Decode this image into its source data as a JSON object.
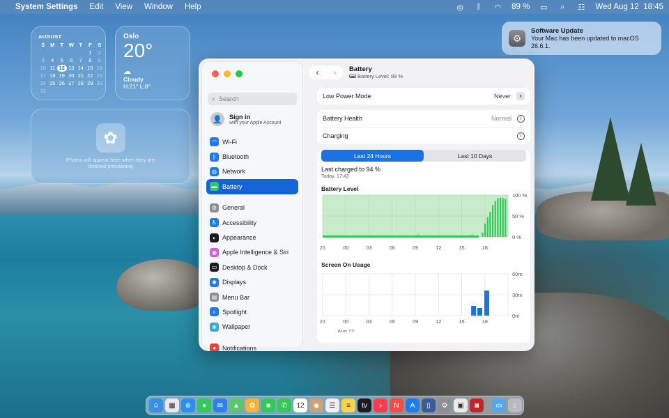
{
  "menubar": {
    "app_name": "System Settings",
    "menus": [
      "Edit",
      "View",
      "Window",
      "Help"
    ],
    "battery": "89 %",
    "datetime": "Wed Aug 12  18:45"
  },
  "calendar": {
    "month": "AUGUST",
    "weekdays": [
      "S",
      "M",
      "T",
      "W",
      "T",
      "F",
      "S"
    ],
    "days": [
      [
        "",
        "",
        "",
        "",
        "",
        "1",
        "2"
      ],
      [
        "3",
        "4",
        "5",
        "6",
        "7",
        "8",
        "9"
      ],
      [
        "10",
        "11",
        "12",
        "13",
        "14",
        "15",
        "16"
      ],
      [
        "17",
        "18",
        "19",
        "20",
        "21",
        "22",
        "23"
      ],
      [
        "24",
        "25",
        "26",
        "27",
        "28",
        "29",
        "30"
      ],
      [
        "31",
        "",
        "",
        "",
        "",
        "",
        ""
      ]
    ],
    "today": "12"
  },
  "weather": {
    "city": "Oslo",
    "temp": "20°",
    "condition": "Cloudy",
    "hilo": "H:21° L:8°"
  },
  "photos": {
    "message": "Photos will appear here when they are finished processing"
  },
  "notification": {
    "title": "Software Update",
    "body": "Your Mac has been updated to macOS 26.6.1."
  },
  "sidebar": {
    "search_placeholder": "Search",
    "signin_title": "Sign in",
    "signin_sub": "with your Apple Account",
    "group1": [
      {
        "label": "Wi-Fi",
        "icon": "wifi-icon",
        "color": "#1e7cf2"
      },
      {
        "label": "Bluetooth",
        "icon": "bluetooth-icon",
        "color": "#1e7cf2"
      },
      {
        "label": "Network",
        "icon": "network-icon",
        "color": "#1e7cf2"
      },
      {
        "label": "Battery",
        "icon": "battery-icon",
        "color": "#34c759",
        "active": true
      }
    ],
    "group2": [
      {
        "label": "General",
        "icon": "gear-icon",
        "color": "#8e8e93"
      },
      {
        "label": "Accessibility",
        "icon": "accessibility-icon",
        "color": "#1e7cf2"
      },
      {
        "label": "Appearance",
        "icon": "appearance-icon",
        "color": "#1c1c1e"
      },
      {
        "label": "Apple Intelligence & Siri",
        "icon": "siri-icon",
        "color": "#d65cd6"
      },
      {
        "label": "Desktop & Dock",
        "icon": "dock-icon",
        "color": "#1c1c1e"
      },
      {
        "label": "Displays",
        "icon": "displays-icon",
        "color": "#1e7cf2"
      },
      {
        "label": "Menu Bar",
        "icon": "menubar-icon",
        "color": "#8e8e93"
      },
      {
        "label": "Spotlight",
        "icon": "spotlight-icon",
        "color": "#1e7cf2"
      },
      {
        "label": "Wallpaper",
        "icon": "wallpaper-icon",
        "color": "#34aadc"
      }
    ],
    "group3": [
      {
        "label": "Notifications",
        "icon": "notifications-icon",
        "color": "#ff3b30"
      }
    ]
  },
  "battery_page": {
    "title": "Battery",
    "subtitle": "Battery Level: 89 %",
    "low_power_label": "Low Power Mode",
    "low_power_value": "Never",
    "health_label": "Battery Health",
    "health_value": "Normal",
    "charging_label": "Charging",
    "tab_24h": "Last 24 Hours",
    "tab_10d": "Last 10 Days",
    "last_charged": "Last charged to 94 %",
    "last_charged_time": "Today, 17:43"
  },
  "chart_data": [
    {
      "type": "bar",
      "title": "Battery Level",
      "x_ticks": [
        "21",
        "00",
        "03",
        "06",
        "09",
        "12",
        "15",
        "18"
      ],
      "y_ticks": [
        "100 %",
        "50 %",
        "0 %"
      ],
      "ylim": [
        0,
        100
      ],
      "charging_span_hours": [
        0,
        22
      ],
      "bars_start_hour": 17.6,
      "values": [
        10,
        32,
        47,
        60,
        76,
        86,
        92,
        94,
        93,
        92
      ],
      "colors": {
        "bar": "#34c759",
        "area": "#c8ebc9",
        "grid": "#b9d9bb"
      }
    },
    {
      "type": "bar",
      "title": "Screen On Usage",
      "x_ticks": [
        "21",
        "00",
        "03",
        "06",
        "09",
        "12",
        "15",
        "18"
      ],
      "x_sub": "Aug 12",
      "y_ticks": [
        "60m",
        "30m",
        "0m"
      ],
      "ylim": [
        0,
        60
      ],
      "bars": [
        {
          "hour": 16.5,
          "minutes": 14
        },
        {
          "hour": 17.3,
          "minutes": 11
        },
        {
          "hour": 18.2,
          "minutes": 36
        }
      ],
      "colors": {
        "bar": "#1a72e3",
        "grid": "#e2e2e6"
      }
    }
  ],
  "dock": [
    {
      "name": "finder-icon",
      "color": "#3a8ee6",
      "glyph": "☺"
    },
    {
      "name": "launchpad-icon",
      "color": "#e8e8ee",
      "glyph": "▦"
    },
    {
      "name": "safari-icon",
      "color": "#2b8ef0",
      "glyph": "⊕"
    },
    {
      "name": "messages-icon",
      "color": "#34c759",
      "glyph": "●"
    },
    {
      "name": "mail-icon",
      "color": "#2e7ff0",
      "glyph": "✉"
    },
    {
      "name": "maps-icon",
      "color": "#5ac86a",
      "glyph": "▲"
    },
    {
      "name": "photos-icon",
      "color": "#f7b23b",
      "glyph": "✿"
    },
    {
      "name": "facetime-icon",
      "color": "#34c759",
      "glyph": "■"
    },
    {
      "name": "phone-icon",
      "color": "#34c759",
      "glyph": "✆"
    },
    {
      "name": "calendar-icon",
      "color": "#ffffff",
      "glyph": "12"
    },
    {
      "name": "contacts-icon",
      "color": "#c8a27a",
      "glyph": "◉"
    },
    {
      "name": "reminders-icon",
      "color": "#f0f0f0",
      "glyph": "☰"
    },
    {
      "name": "notes-icon",
      "color": "#f7d44c",
      "glyph": "≡"
    },
    {
      "name": "tv-icon",
      "color": "#1c1c1e",
      "glyph": "tv"
    },
    {
      "name": "music-icon",
      "color": "#fa3c4c",
      "glyph": "♪"
    },
    {
      "name": "news-icon",
      "color": "#f14b4b",
      "glyph": "N"
    },
    {
      "name": "appstore-icon",
      "color": "#1e7cf2",
      "glyph": "A"
    },
    {
      "name": "iphone-mirroring-icon",
      "color": "#3c5a9a",
      "glyph": "▯"
    },
    {
      "name": "system-settings-icon",
      "color": "#8e8e93",
      "glyph": "⚙"
    },
    {
      "name": "preview-icon",
      "color": "#eaeaea",
      "glyph": "▣"
    },
    {
      "name": "photo-booth-icon",
      "color": "#c6242b",
      "glyph": "◙"
    },
    {
      "name": "downloads-folder-icon",
      "color": "#58a6e8",
      "glyph": "▭"
    },
    {
      "name": "trash-icon",
      "color": "#b8bcc2",
      "glyph": "⌂"
    }
  ]
}
